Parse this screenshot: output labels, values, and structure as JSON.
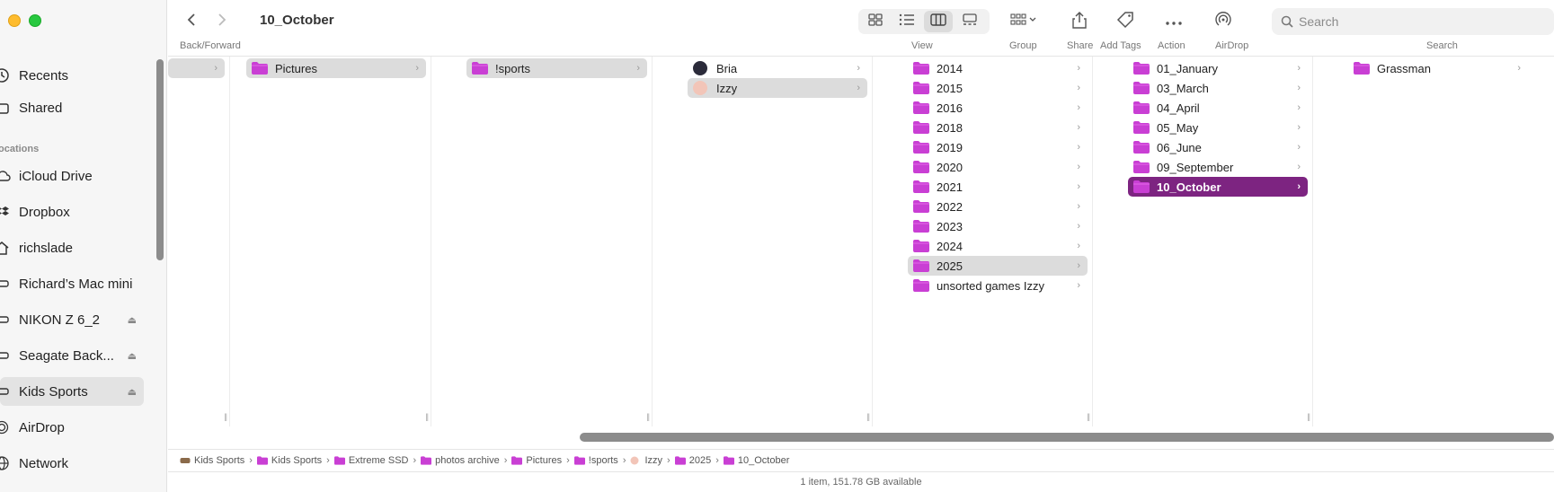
{
  "window": {
    "title": "10_October"
  },
  "sidebar": {
    "locations_heading": "ocations",
    "items": [
      {
        "label": "Recents",
        "icon": "clock-icon"
      },
      {
        "label": "Shared",
        "icon": "shared-folder-icon"
      },
      {
        "label": "iCloud Drive",
        "icon": "cloud-icon"
      },
      {
        "label": "Dropbox",
        "icon": "dropbox-icon"
      },
      {
        "label": "richslade",
        "icon": "home-icon"
      },
      {
        "label": "Richard’s Mac mini",
        "icon": "computer-icon"
      },
      {
        "label": "NIKON Z 6_2",
        "icon": "drive-icon",
        "eject": "⏏"
      },
      {
        "label": "Seagate Back...",
        "icon": "drive-icon",
        "eject": "⏏"
      },
      {
        "label": "Kids Sports",
        "icon": "drive-icon",
        "eject": "⏏",
        "selected": true
      },
      {
        "label": "AirDrop",
        "icon": "airdrop-icon"
      },
      {
        "label": "Network",
        "icon": "globe-icon"
      }
    ]
  },
  "toolbar": {
    "back_forward_label": "Back/Forward",
    "view_label": "View",
    "group_label": "Group",
    "share_label": "Share",
    "add_tags_label": "Add Tags",
    "action_label": "Action",
    "airdrop_label": "AirDrop",
    "search_label": "Search",
    "search_placeholder": "Search"
  },
  "columns": {
    "col2": [
      {
        "label": "Pictures"
      }
    ],
    "col3": [
      {
        "label": "!sports"
      }
    ],
    "col4": [
      {
        "label": "Bria"
      },
      {
        "label": "Izzy"
      }
    ],
    "col5": [
      {
        "label": "2014"
      },
      {
        "label": "2015"
      },
      {
        "label": "2016"
      },
      {
        "label": "2018"
      },
      {
        "label": "2019"
      },
      {
        "label": "2020"
      },
      {
        "label": "2021"
      },
      {
        "label": "2022"
      },
      {
        "label": "2023"
      },
      {
        "label": "2024"
      },
      {
        "label": "2025"
      },
      {
        "label": "unsorted  games Izzy"
      }
    ],
    "col6": [
      {
        "label": "01_January"
      },
      {
        "label": "03_March"
      },
      {
        "label": "04_April"
      },
      {
        "label": "05_May"
      },
      {
        "label": "06_June"
      },
      {
        "label": "09_September"
      },
      {
        "label": "10_October"
      }
    ],
    "col7": [
      {
        "label": "Grassman"
      }
    ]
  },
  "pathbar": [
    {
      "label": "Kids Sports",
      "icon": "drive-icon"
    },
    {
      "label": "Kids Sports",
      "icon": "folder-icon"
    },
    {
      "label": "Extreme SSD",
      "icon": "folder-icon"
    },
    {
      "label": "photos archive",
      "icon": "folder-icon"
    },
    {
      "label": "Pictures",
      "icon": "folder-icon"
    },
    {
      "label": "!sports",
      "icon": "folder-icon"
    },
    {
      "label": "Izzy",
      "icon": "person-icon"
    },
    {
      "label": "2025",
      "icon": "folder-icon"
    },
    {
      "label": "10_October",
      "icon": "folder-icon"
    }
  ],
  "status": {
    "text": "1 item, 151.78 GB available"
  },
  "colors": {
    "folder": "#c93fd4",
    "selection": "#7d2481"
  }
}
